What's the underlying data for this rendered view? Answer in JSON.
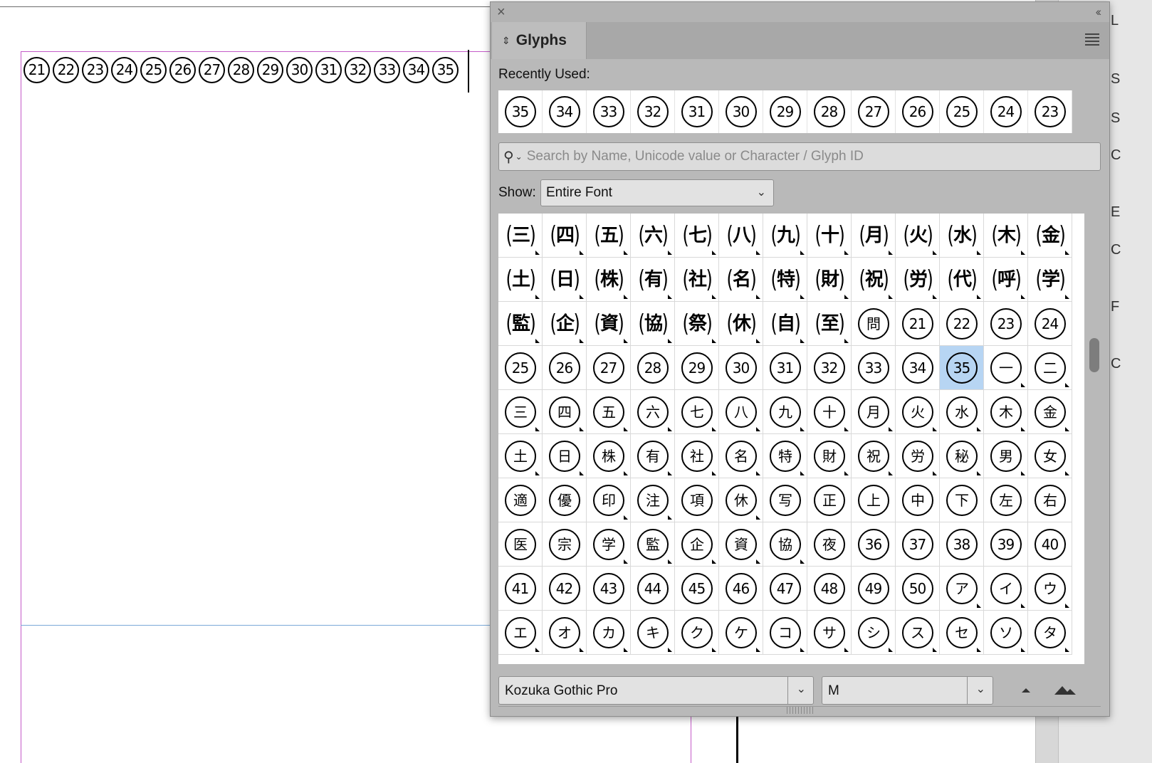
{
  "document": {
    "text_frame_glyphs": [
      "21",
      "22",
      "23",
      "24",
      "25",
      "26",
      "27",
      "28",
      "29",
      "30",
      "31",
      "32",
      "33",
      "34",
      "35"
    ]
  },
  "side_panel": {
    "letters": [
      "L",
      "S",
      "S",
      "C",
      "E",
      "C",
      "F",
      "C"
    ]
  },
  "glyph_panel": {
    "close_icon": "×",
    "collapse_icon": "‹‹",
    "tab_label": "Glyphs",
    "recently_used_label": "Recently Used:",
    "recently_used": [
      "35",
      "34",
      "33",
      "32",
      "31",
      "30",
      "29",
      "28",
      "27",
      "26",
      "25",
      "24",
      "23"
    ],
    "search": {
      "placeholder": "Search by Name, Unicode value or Character / Glyph ID",
      "value": ""
    },
    "show_label": "Show:",
    "show_value": "Entire Font",
    "font_family": "Kozuka Gothic Pro",
    "font_style": "M",
    "selected_glyph": "35",
    "grid_rows": [
      [
        [
          "p",
          "三",
          1
        ],
        [
          "p",
          "四",
          1
        ],
        [
          "p",
          "五",
          1
        ],
        [
          "p",
          "六",
          1
        ],
        [
          "p",
          "七",
          1
        ],
        [
          "p",
          "八",
          1
        ],
        [
          "p",
          "九",
          1
        ],
        [
          "p",
          "十",
          1
        ],
        [
          "p",
          "月",
          1
        ],
        [
          "p",
          "火",
          1
        ],
        [
          "p",
          "水",
          1
        ],
        [
          "p",
          "木",
          1
        ],
        [
          "p",
          "金",
          1
        ]
      ],
      [
        [
          "p",
          "土",
          1
        ],
        [
          "p",
          "日",
          1
        ],
        [
          "p",
          "株",
          1
        ],
        [
          "p",
          "有",
          1
        ],
        [
          "p",
          "社",
          1
        ],
        [
          "p",
          "名",
          1
        ],
        [
          "p",
          "特",
          1
        ],
        [
          "p",
          "財",
          1
        ],
        [
          "p",
          "祝",
          1
        ],
        [
          "p",
          "労",
          1
        ],
        [
          "p",
          "代",
          1
        ],
        [
          "p",
          "呼",
          1
        ],
        [
          "p",
          "学",
          1
        ]
      ],
      [
        [
          "p",
          "監",
          1
        ],
        [
          "p",
          "企",
          1
        ],
        [
          "p",
          "資",
          1
        ],
        [
          "p",
          "協",
          1
        ],
        [
          "p",
          "祭",
          1
        ],
        [
          "p",
          "休",
          1
        ],
        [
          "p",
          "自",
          1
        ],
        [
          "p",
          "至",
          1
        ],
        [
          "c",
          "問",
          0
        ],
        [
          "c",
          "21",
          0
        ],
        [
          "c",
          "22",
          0
        ],
        [
          "c",
          "23",
          0
        ],
        [
          "c",
          "24",
          0
        ]
      ],
      [
        [
          "c",
          "25",
          0
        ],
        [
          "c",
          "26",
          0
        ],
        [
          "c",
          "27",
          0
        ],
        [
          "c",
          "28",
          0
        ],
        [
          "c",
          "29",
          0
        ],
        [
          "c",
          "30",
          0
        ],
        [
          "c",
          "31",
          0
        ],
        [
          "c",
          "32",
          0
        ],
        [
          "c",
          "33",
          0
        ],
        [
          "c",
          "34",
          0
        ],
        [
          "c",
          "35",
          0
        ],
        [
          "c",
          "一",
          1
        ],
        [
          "c",
          "二",
          1
        ]
      ],
      [
        [
          "c",
          "三",
          1
        ],
        [
          "c",
          "四",
          1
        ],
        [
          "c",
          "五",
          1
        ],
        [
          "c",
          "六",
          1
        ],
        [
          "c",
          "七",
          1
        ],
        [
          "c",
          "八",
          1
        ],
        [
          "c",
          "九",
          1
        ],
        [
          "c",
          "十",
          1
        ],
        [
          "c",
          "月",
          1
        ],
        [
          "c",
          "火",
          1
        ],
        [
          "c",
          "水",
          1
        ],
        [
          "c",
          "木",
          1
        ],
        [
          "c",
          "金",
          1
        ]
      ],
      [
        [
          "c",
          "土",
          1
        ],
        [
          "c",
          "日",
          1
        ],
        [
          "c",
          "株",
          1
        ],
        [
          "c",
          "有",
          1
        ],
        [
          "c",
          "社",
          1
        ],
        [
          "c",
          "名",
          1
        ],
        [
          "c",
          "特",
          1
        ],
        [
          "c",
          "財",
          1
        ],
        [
          "c",
          "祝",
          1
        ],
        [
          "c",
          "労",
          1
        ],
        [
          "c",
          "秘",
          1
        ],
        [
          "c",
          "男",
          1
        ],
        [
          "c",
          "女",
          1
        ]
      ],
      [
        [
          "c",
          "適",
          0
        ],
        [
          "c",
          "優",
          0
        ],
        [
          "c",
          "印",
          1
        ],
        [
          "c",
          "注",
          1
        ],
        [
          "c",
          "項",
          0
        ],
        [
          "c",
          "休",
          1
        ],
        [
          "c",
          "写",
          0
        ],
        [
          "c",
          "正",
          0
        ],
        [
          "c",
          "上",
          0
        ],
        [
          "c",
          "中",
          0
        ],
        [
          "c",
          "下",
          0
        ],
        [
          "c",
          "左",
          0
        ],
        [
          "c",
          "右",
          0
        ]
      ],
      [
        [
          "c",
          "医",
          0
        ],
        [
          "c",
          "宗",
          0
        ],
        [
          "c",
          "学",
          1
        ],
        [
          "c",
          "監",
          1
        ],
        [
          "c",
          "企",
          1
        ],
        [
          "c",
          "資",
          1
        ],
        [
          "c",
          "協",
          1
        ],
        [
          "c",
          "夜",
          0
        ],
        [
          "c",
          "36",
          0
        ],
        [
          "c",
          "37",
          0
        ],
        [
          "c",
          "38",
          0
        ],
        [
          "c",
          "39",
          0
        ],
        [
          "c",
          "40",
          0
        ]
      ],
      [
        [
          "c",
          "41",
          0
        ],
        [
          "c",
          "42",
          0
        ],
        [
          "c",
          "43",
          0
        ],
        [
          "c",
          "44",
          0
        ],
        [
          "c",
          "45",
          0
        ],
        [
          "c",
          "46",
          0
        ],
        [
          "c",
          "47",
          0
        ],
        [
          "c",
          "48",
          0
        ],
        [
          "c",
          "49",
          0
        ],
        [
          "c",
          "50",
          0
        ],
        [
          "c",
          "ア",
          1
        ],
        [
          "c",
          "イ",
          1
        ],
        [
          "c",
          "ウ",
          1
        ]
      ],
      [
        [
          "c",
          "エ",
          1
        ],
        [
          "c",
          "オ",
          1
        ],
        [
          "c",
          "カ",
          1
        ],
        [
          "c",
          "キ",
          1
        ],
        [
          "c",
          "ク",
          1
        ],
        [
          "c",
          "ケ",
          1
        ],
        [
          "c",
          "コ",
          1
        ],
        [
          "c",
          "サ",
          1
        ],
        [
          "c",
          "シ",
          1
        ],
        [
          "c",
          "ス",
          1
        ],
        [
          "c",
          "セ",
          1
        ],
        [
          "c",
          "ソ",
          1
        ],
        [
          "c",
          "タ",
          1
        ]
      ]
    ]
  },
  "colors": {
    "selection": "#b7d5f3",
    "margin_guide": "#c45ac8",
    "column_guide": "#7aa9d8",
    "panel_bg": "#b9b9b9"
  }
}
